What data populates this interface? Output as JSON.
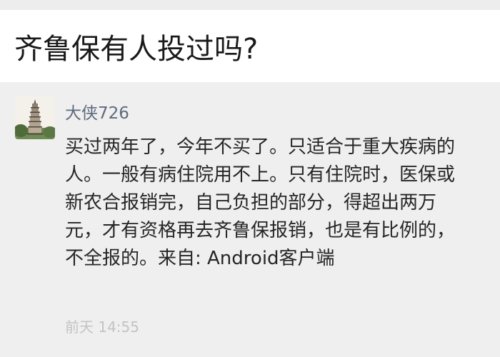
{
  "thread": {
    "title": "齐鲁保有人投过吗?"
  },
  "post": {
    "username": "大侠726",
    "avatar_icon": "pagoda-avatar-icon",
    "body_lines": [
      "买过两年了，今年不买了。只适合于重大疾病的",
      "人。一般有病住院用不上。只有住院时，医保或",
      "新农合报销完，自己负担的部分，得超出两万",
      "元，才有资格再去齐鲁保报销，也是有比例的，",
      "不全报的。来自: Android客户端"
    ],
    "timestamp": "前天 14:55"
  },
  "colors": {
    "title_bar_bg": "#ffffff",
    "post_bg": "#efefef",
    "username": "#5d6b7e",
    "body_text": "#262626",
    "timestamp": "#c3c3c3"
  }
}
